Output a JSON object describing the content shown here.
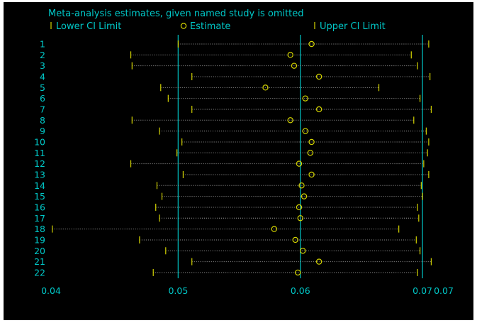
{
  "chart_data": {
    "type": "scatter",
    "title": "Meta-analysis estimates, given named study is omitted",
    "legend": {
      "placement": "top",
      "entries": [
        {
          "key": "lower",
          "label": "Lower CI Limit"
        },
        {
          "key": "estimate",
          "label": "Estimate"
        },
        {
          "key": "upper",
          "label": "Upper CI Limit"
        }
      ]
    },
    "x_ticks": [
      "0.04",
      "0.05",
      "0.06",
      "0.07",
      "0.07"
    ],
    "x_tick_values": [
      0.0403,
      0.0505,
      0.0603,
      0.0701,
      0.0718
    ],
    "reference_lines": [
      0.0505,
      0.0603,
      0.0701
    ],
    "xlim": [
      0.0403,
      0.0718
    ],
    "studies": [
      {
        "label": "1",
        "lower": 0.0505,
        "estimate": 0.0612,
        "upper": 0.0706
      },
      {
        "label": "2",
        "lower": 0.0467,
        "estimate": 0.0595,
        "upper": 0.0692
      },
      {
        "label": "3",
        "lower": 0.0468,
        "estimate": 0.0598,
        "upper": 0.0697
      },
      {
        "label": "4",
        "lower": 0.0516,
        "estimate": 0.0618,
        "upper": 0.0707
      },
      {
        "label": "5",
        "lower": 0.0491,
        "estimate": 0.0575,
        "upper": 0.0666
      },
      {
        "label": "6",
        "lower": 0.0497,
        "estimate": 0.0607,
        "upper": 0.0699
      },
      {
        "label": "7",
        "lower": 0.0516,
        "estimate": 0.0618,
        "upper": 0.0708
      },
      {
        "label": "8",
        "lower": 0.0468,
        "estimate": 0.0595,
        "upper": 0.0694
      },
      {
        "label": "9",
        "lower": 0.049,
        "estimate": 0.0607,
        "upper": 0.0704
      },
      {
        "label": "10",
        "lower": 0.0508,
        "estimate": 0.0612,
        "upper": 0.0706
      },
      {
        "label": "11",
        "lower": 0.0504,
        "estimate": 0.0611,
        "upper": 0.0705
      },
      {
        "label": "12",
        "lower": 0.0467,
        "estimate": 0.0602,
        "upper": 0.0702
      },
      {
        "label": "13",
        "lower": 0.0509,
        "estimate": 0.0612,
        "upper": 0.0706
      },
      {
        "label": "14",
        "lower": 0.0488,
        "estimate": 0.0604,
        "upper": 0.07
      },
      {
        "label": "15",
        "lower": 0.0492,
        "estimate": 0.0606,
        "upper": 0.0701
      },
      {
        "label": "16",
        "lower": 0.0487,
        "estimate": 0.0602,
        "upper": 0.0697
      },
      {
        "label": "17",
        "lower": 0.049,
        "estimate": 0.0603,
        "upper": 0.0698
      },
      {
        "label": "18",
        "lower": 0.0404,
        "estimate": 0.0582,
        "upper": 0.0682
      },
      {
        "label": "19",
        "lower": 0.0474,
        "estimate": 0.0599,
        "upper": 0.0696
      },
      {
        "label": "20",
        "lower": 0.0495,
        "estimate": 0.0605,
        "upper": 0.0699
      },
      {
        "label": "21",
        "lower": 0.0516,
        "estimate": 0.0618,
        "upper": 0.0708
      },
      {
        "label": "22",
        "lower": 0.0485,
        "estimate": 0.0601,
        "upper": 0.0697
      }
    ],
    "colors": {
      "background": "#000000",
      "text": "#00c8c8",
      "reference_line": "#00a8a8",
      "estimate": "#d4d400",
      "ci_marker": "#d4d400",
      "ci_line": "#a0a0a0"
    },
    "grid": false
  }
}
